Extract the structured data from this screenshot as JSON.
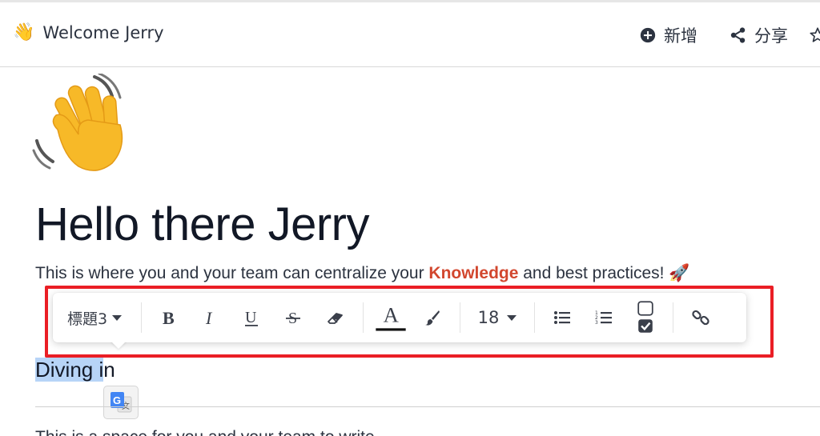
{
  "header": {
    "title": "Welcome Jerry",
    "emoji": "👋",
    "add_label": "新增",
    "share_label": "分享"
  },
  "page": {
    "heading": "Hello there Jerry",
    "intro_before": "This is where you and your team can centralize your ",
    "intro_keyword": "Knowledge",
    "intro_after": " and best practices! 🚀",
    "subheading_selected": "Diving i",
    "subheading_rest": "n",
    "partial_text": "This is a space for you and your team to write"
  },
  "toolbar": {
    "heading_level": "標題3",
    "font_size": "18",
    "icons": [
      "bold-icon",
      "italic-icon",
      "underline-icon",
      "strikethrough-icon",
      "eraser-icon",
      "text-color-icon",
      "highlight-brush-icon",
      "bullet-list-icon",
      "numbered-list-icon",
      "checklist-icon",
      "link-icon"
    ]
  },
  "colors": {
    "accent": "#d2472e",
    "highlight_border": "#ea1e25",
    "selection": "#b7d4f7"
  }
}
